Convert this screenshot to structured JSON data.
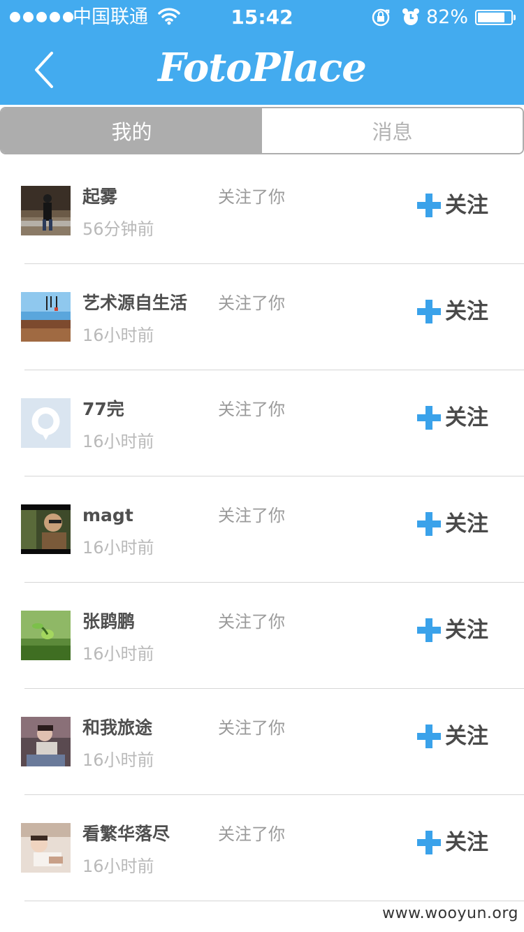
{
  "status_bar": {
    "carrier": "中国联通",
    "time": "15:42",
    "battery_percent": "82%",
    "battery_level": 0.82,
    "icons": [
      "signal-dots-icon",
      "wifi-icon",
      "rotation-lock-icon",
      "alarm-icon",
      "battery-icon"
    ]
  },
  "nav": {
    "back_icon": "chevron-left-icon",
    "logo_text": "FotoPlace"
  },
  "tabs": [
    {
      "label": "我的",
      "selected": true
    },
    {
      "label": "消息",
      "selected": false
    }
  ],
  "colors": {
    "header_bg": "#43abef",
    "tab_selected_bg": "#adadad",
    "follow_plus": "#3aa2ea"
  },
  "follow_label": "关注",
  "items": [
    {
      "name": "起雾",
      "time": "56分钟前",
      "action": "关注了你"
    },
    {
      "name": "艺术源自生活",
      "time": "16小时前",
      "action": "关注了你"
    },
    {
      "name": "77完",
      "time": "16小时前",
      "action": "关注了你"
    },
    {
      "name": "magt",
      "time": "16小时前",
      "action": "关注了你"
    },
    {
      "name": "张鹍鹏",
      "time": "16小时前",
      "action": "关注了你"
    },
    {
      "name": "和我旅途",
      "time": "16小时前",
      "action": "关注了你"
    },
    {
      "name": "看繁华落尽",
      "time": "16小时前",
      "action": "关注了你"
    }
  ],
  "watermark": "www.wooyun.org"
}
